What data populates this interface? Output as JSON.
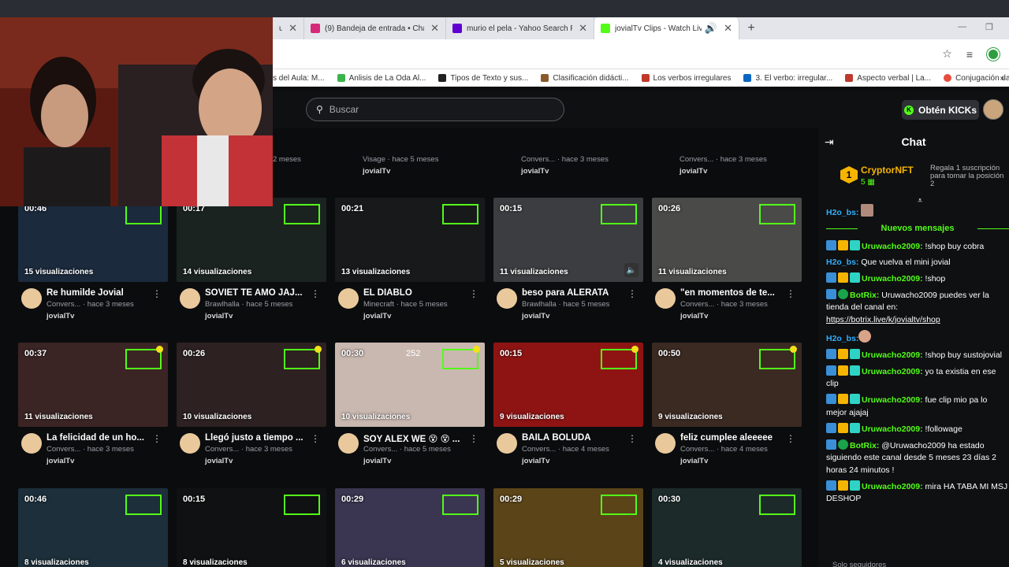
{
  "browser": {
    "tabs": [
      {
        "title": "ufe",
        "favicon_color": "#2f6fd6"
      },
      {
        "title": "(9) Bandeja de entrada • Chats",
        "favicon_color": "#d6297a"
      },
      {
        "title": "murio el pela - Yahoo Search Re",
        "favicon_color": "#6001d2"
      },
      {
        "title": "jovialTv Clips - Watch Live o",
        "favicon_color": "#53fc18"
      }
    ],
    "new_tab": "+",
    "bookmarks": [
      {
        "label": "s del Aula: M...",
        "color": "#888888"
      },
      {
        "label": "Anlisis de La Oda Al...",
        "color": "#3bb54a"
      },
      {
        "label": "Tipos de Texto y sus...",
        "color": "#222222"
      },
      {
        "label": "Clasificación didácti...",
        "color": "#8b5a2b"
      },
      {
        "label": "Los verbos irregulares",
        "color": "#c0392b"
      },
      {
        "label": "3. El verbo: irregular...",
        "color": "#0a66c2"
      },
      {
        "label": "Aspecto verbal | La...",
        "color": "#c0392b"
      },
      {
        "label": "Conjugación dar | C...",
        "color": "#e74c3c"
      }
    ],
    "more": "»"
  },
  "header": {
    "search_placeholder": "Buscar",
    "kicks_button": "Obtén KICKs"
  },
  "top_row": [
    {
      "sub": "2 meses",
      "user": ""
    },
    {
      "sub": "Visage · hace 5 meses",
      "user": "jovialTv"
    },
    {
      "sub": "Convers... · hace 3 meses",
      "user": "jovialTv"
    },
    {
      "sub": "Convers... · hace 3 meses",
      "user": "jovialTv"
    }
  ],
  "clips": [
    [
      {
        "duration": "00:46",
        "views": "15 visualizaciones",
        "title": "Re humilde Jovial",
        "sub": "Convers... · hace 3 meses",
        "user": "jovialTv",
        "tint": "#1b2a3d"
      },
      {
        "duration": "00:17",
        "views": "14 visualizaciones",
        "title": "SOVIET TE AMO JAJ...",
        "sub": "Brawlhalla · hace 5 meses",
        "user": "jovialTv",
        "tint": "#1a2320"
      },
      {
        "duration": "00:21",
        "views": "13 visualizaciones",
        "title": "EL DIABLO",
        "sub": "Minecraft · hace 5 meses",
        "user": "jovialTv",
        "tint": "#17191b"
      },
      {
        "duration": "00:15",
        "views": "11 visualizaciones",
        "title": "beso para ALERATA",
        "sub": "Brawlhalla · hace 5 meses",
        "user": "jovialTv",
        "tint": "#3b3d40"
      },
      {
        "duration": "00:26",
        "views": "11 visualizaciones",
        "title": "\"en momentos de te...",
        "sub": "Convers... · hace 3 meses",
        "user": "jovialTv",
        "tint": "#4a4a48"
      }
    ],
    [
      {
        "duration": "00:37",
        "views": "11 visualizaciones",
        "title": "La felicidad de un ho...",
        "sub": "Convers... · hace 3 meses",
        "user": "jovialTv",
        "tint": "#3b2424"
      },
      {
        "duration": "00:26",
        "views": "10 visualizaciones",
        "title": "Llegó justo a tiempo ...",
        "sub": "Convers... · hace 3 meses",
        "user": "jovialTv",
        "tint": "#2d2121"
      },
      {
        "duration": "00:30",
        "views": "10 visualizaciones",
        "title": "SOY ALEX WE 😵 😵 ...",
        "sub": "Convers... · hace 5 meses",
        "user": "jovialTv",
        "tint": "#c9b8b0"
      },
      {
        "duration": "00:15",
        "views": "9 visualizaciones",
        "title": "BAILÁ BOLUDA",
        "sub": "Convers... · hace 4 meses",
        "user": "jovialTv",
        "tint": "#8e1414"
      },
      {
        "duration": "00:50",
        "views": "9 visualizaciones",
        "title": "feliz cumplee aleeeee",
        "sub": "Convers... · hace 4 meses",
        "user": "jovialTv",
        "tint": "#3a2a22"
      }
    ],
    [
      {
        "duration": "00:46",
        "views": "8 visualizaciones",
        "tint": "#1c2f3a"
      },
      {
        "duration": "00:15",
        "views": "8 visualizaciones",
        "tint": "#101112"
      },
      {
        "duration": "00:29",
        "views": "6 visualizaciones",
        "tint": "#3a3550"
      },
      {
        "duration": "00:29",
        "views": "5 visualizaciones",
        "tint": "#5a4418"
      },
      {
        "duration": "00:30",
        "views": "4 visualizaciones",
        "tint": "#1d2a2a"
      }
    ]
  ],
  "extra_labels": {
    "thumb_number": "252"
  },
  "chat": {
    "title": "Chat",
    "pinned_name": "CryptorNFT",
    "pinned_count": "5",
    "pinned_badge": "1",
    "pinned_rule": "Regala 1 suscripción para tomar la posición 2",
    "first_user": "H2o_bs:",
    "new_messages": "Nuevos mensajes",
    "messages": [
      {
        "user": "Uruwacho2009:",
        "text": " !shop buy cobra",
        "style": "green",
        "badges": 3
      },
      {
        "user": "H2o_bs:",
        "text": " Que vuelva el mini jovial",
        "style": "blue",
        "badges": 0
      },
      {
        "user": "Uruwacho2009:",
        "text": " !shop",
        "style": "green",
        "badges": 3
      },
      {
        "user": "BotRix:",
        "text": " Uruwacho2009 puedes ver la tienda del canal en: ",
        "link": "https://botrix.live/k/jovialtv/shop",
        "style": "green",
        "badges": 2
      },
      {
        "user": "H2o_bs:",
        "text": "",
        "style": "blue",
        "badges": 0
      },
      {
        "user": "Uruwacho2009:",
        "text": " !shop buy sustojovial",
        "style": "green",
        "badges": 3
      },
      {
        "user": "Uruwacho2009:",
        "text": " yo ta existia en ese clip",
        "style": "green",
        "badges": 3
      },
      {
        "user": "Uruwacho2009:",
        "text": " fue clip mio pa lo mejor ajajaj",
        "style": "green",
        "badges": 3
      },
      {
        "user": "Uruwacho2009:",
        "text": " !followage",
        "style": "green",
        "badges": 3
      },
      {
        "user": "BotRix:",
        "text": " @Uruwacho2009 ha estado siguiendo este canal desde 5 meses 23 días 2 horas 24 minutos !",
        "style": "green",
        "badges": 2
      },
      {
        "user": "Uruwacho2009:",
        "text": " mira HA TABA MI MSJ DESHOP",
        "style": "green",
        "badges": 3
      }
    ],
    "footer": "Solo seguidores"
  }
}
